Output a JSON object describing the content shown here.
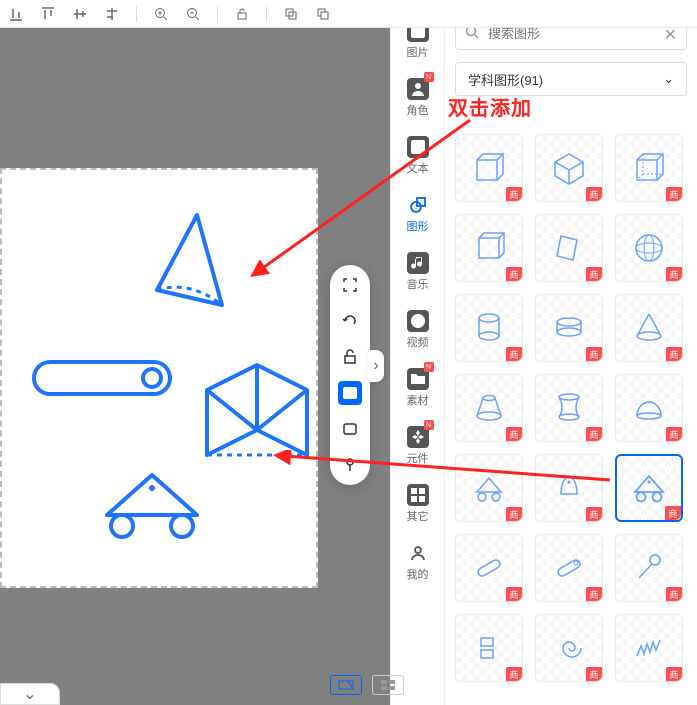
{
  "toolbar": {
    "icons": [
      "align-bottom",
      "align-top",
      "align-v-center",
      "align-h-baseline",
      "zoom-in",
      "zoom-out",
      "unlock",
      "copy",
      "clone"
    ]
  },
  "side_tabs": [
    {
      "id": "image",
      "label": "图片",
      "badge": "N"
    },
    {
      "id": "role",
      "label": "角色",
      "badge": "N"
    },
    {
      "id": "text",
      "label": "文本"
    },
    {
      "id": "shape",
      "label": "图形",
      "active": true
    },
    {
      "id": "music",
      "label": "音乐"
    },
    {
      "id": "video",
      "label": "视频"
    },
    {
      "id": "material",
      "label": "素材",
      "badge": "N"
    },
    {
      "id": "component",
      "label": "元件",
      "badge": "N"
    },
    {
      "id": "other",
      "label": "其它"
    },
    {
      "id": "mine",
      "label": "我的"
    }
  ],
  "search": {
    "placeholder": "搜索图形"
  },
  "category": {
    "label": "学科图形(91)"
  },
  "hint": "双击添加",
  "cell_tag": "商",
  "float_toolbar": [
    "fullscreen",
    "rotate",
    "lock-open",
    "rect-fill",
    "rect-outline",
    "pin"
  ],
  "grid": {
    "rows": 7,
    "cols": 3,
    "items": [
      {
        "icon": "cube-front",
        "tag": true
      },
      {
        "icon": "cube-persp",
        "tag": true
      },
      {
        "icon": "cube-dash",
        "tag": true
      },
      {
        "icon": "cube-iso",
        "tag": true
      },
      {
        "icon": "rhombus-3d",
        "tag": true
      },
      {
        "icon": "sphere",
        "tag": true
      },
      {
        "icon": "cylinder",
        "tag": true
      },
      {
        "icon": "cylinder-flat",
        "tag": true
      },
      {
        "icon": "cone",
        "tag": true
      },
      {
        "icon": "frustum",
        "tag": true
      },
      {
        "icon": "hyperboloid",
        "tag": true
      },
      {
        "icon": "dome",
        "tag": true
      },
      {
        "icon": "tri-wheels-small",
        "tag": true
      },
      {
        "icon": "bell",
        "tag": true
      },
      {
        "icon": "tri-wheels",
        "tag": true,
        "selected": true
      },
      {
        "icon": "capsule-diag",
        "tag": true
      },
      {
        "icon": "capsule-diag2",
        "tag": true
      },
      {
        "icon": "flag-pin",
        "tag": true
      },
      {
        "icon": "stack",
        "tag": true
      },
      {
        "icon": "spiral",
        "tag": true
      },
      {
        "icon": "zigzag",
        "tag": true
      }
    ]
  }
}
